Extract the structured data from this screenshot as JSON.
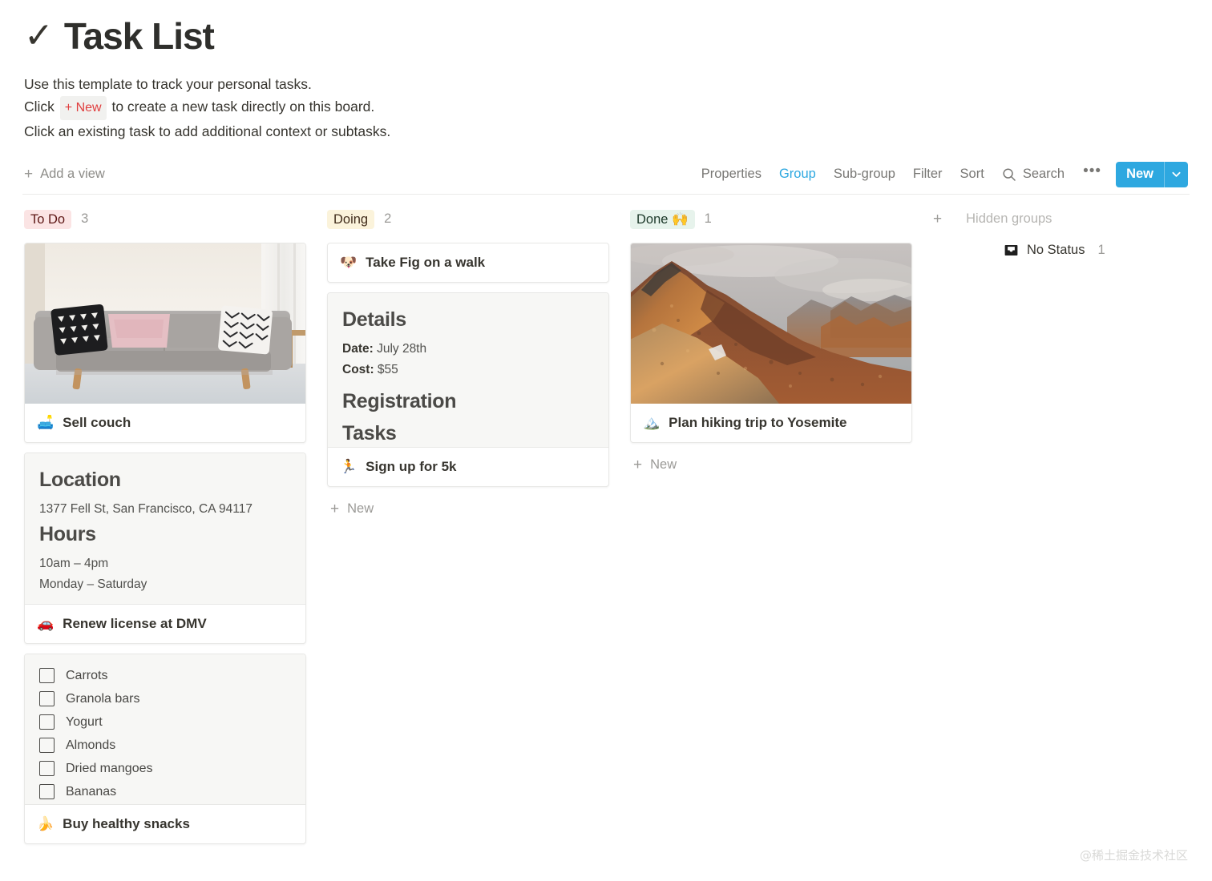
{
  "header": {
    "icon": "check-mark",
    "title": "Task List",
    "desc_line1": "Use this template to track your personal tasks.",
    "desc_line2_pre": "Click",
    "desc_line2_badge": "+ New",
    "desc_line2_post": "to create a new task directly on this board.",
    "desc_line3": "Click an existing task to add additional context or subtasks."
  },
  "toolbar": {
    "add_view": "Add a view",
    "properties": "Properties",
    "group": "Group",
    "sub_group": "Sub-group",
    "filter": "Filter",
    "sort": "Sort",
    "search": "Search",
    "more": "•••",
    "new_label": "New",
    "accent_color": "#2ea8e0"
  },
  "board": {
    "new_label": "New",
    "columns": [
      {
        "name": "To Do",
        "badge_color": "#fbe4e4",
        "badge_text_color": "#5d1715",
        "count": "3",
        "cards": [
          {
            "kind": "cover",
            "emoji": "🛋️",
            "title": "Sell couch",
            "cover_alt": "gray-couch-photo"
          },
          {
            "kind": "preview",
            "emoji": "🚗",
            "title": "Renew license at DMV",
            "preview": [
              {
                "type": "h",
                "text": "Location"
              },
              {
                "type": "p",
                "text": "1377 Fell St, San Francisco, CA 94117"
              },
              {
                "type": "h",
                "text": "Hours"
              },
              {
                "type": "p",
                "text": "10am – 4pm"
              },
              {
                "type": "p",
                "text": "Monday – Saturday"
              }
            ]
          },
          {
            "kind": "checklist",
            "emoji": "🍌",
            "title": "Buy healthy snacks",
            "items": [
              "Carrots",
              "Granola bars",
              "Yogurt",
              "Almonds",
              "Dried mangoes",
              "Bananas"
            ]
          }
        ]
      },
      {
        "name": "Doing",
        "badge_color": "#fbf3db",
        "badge_text_color": "#402c1b",
        "count": "2",
        "cards": [
          {
            "kind": "plain",
            "emoji": "🐶",
            "title": "Take Fig on a walk"
          },
          {
            "kind": "preview",
            "emoji": "🏃",
            "title": "Sign up for 5k",
            "preview": [
              {
                "type": "h",
                "text": "Details"
              },
              {
                "type": "p",
                "text": "Date: July 28th",
                "label": "Date:",
                "value": " July 28th"
              },
              {
                "type": "p",
                "text": "Cost: $55",
                "label": "Cost:",
                "value": " $55"
              },
              {
                "type": "h",
                "text": "Registration"
              },
              {
                "type": "h",
                "text": "Tasks"
              }
            ]
          }
        ]
      },
      {
        "name": "Done 🙌",
        "badge_color": "#e7f3ec",
        "badge_text_color": "#1c3829",
        "count": "1",
        "cards": [
          {
            "kind": "cover",
            "emoji": "🏔️",
            "title": "Plan hiking trip to Yosemite",
            "cover_alt": "mountain-ridge-sunset-photo"
          }
        ]
      }
    ]
  },
  "hidden_groups": {
    "label": "Hidden groups",
    "add_icon": "plus-icon",
    "items": [
      {
        "icon": "inbox-icon",
        "name": "No Status",
        "count": "1"
      }
    ]
  },
  "watermark": "@稀土掘金技术社区"
}
